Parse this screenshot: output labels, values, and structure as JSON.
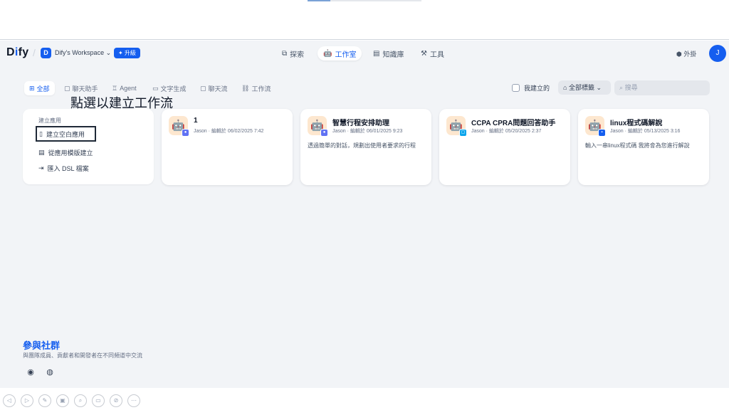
{
  "header": {
    "logo_pre": "D",
    "logo_accent": "i",
    "logo_post": "fy",
    "workspace_initial": "D",
    "workspace_name": "Dify's Workspace",
    "upgrade_label": "✦ 升級",
    "nav": [
      {
        "label": "探索",
        "icon": "compass-icon"
      },
      {
        "label": "工作室",
        "icon": "robot-icon"
      },
      {
        "label": "知識庫",
        "icon": "book-icon"
      },
      {
        "label": "工具",
        "icon": "hammer-icon"
      }
    ],
    "ext_label": "外掛",
    "avatar_initial": "J"
  },
  "tabs": [
    {
      "label": "全部",
      "icon": "grid-icon"
    },
    {
      "label": "聊天助手",
      "icon": "chat-icon"
    },
    {
      "label": "Agent",
      "icon": "agent-icon"
    },
    {
      "label": "文字生成",
      "icon": "text-icon"
    },
    {
      "label": "聊天流",
      "icon": "chatflow-icon"
    },
    {
      "label": "工作流",
      "icon": "workflow-icon"
    }
  ],
  "overlay_text": "點選以建立工作流",
  "filters": {
    "mine_label": "我建立的",
    "tags_label": "全部標籤",
    "search_placeholder": "搜尋"
  },
  "create": {
    "title": "建立應用",
    "blank": "建立空白應用",
    "template": "從應用模版建立",
    "dsl": "匯入 DSL 檔案"
  },
  "apps": [
    {
      "title": "1",
      "meta": "Jason · 編輯於 06/02/2025 7:42",
      "desc": "",
      "badge_color": "#6172f3"
    },
    {
      "title": "智慧行程安排助理",
      "meta": "Jason · 編輯於 06/01/2025 9:23",
      "desc": "透過簡單的對話，規劃出使用者要求的行程",
      "badge_color": "#6172f3"
    },
    {
      "title": "CCPA CPRA問題回答助手",
      "meta": "Jason · 編輯於 05/20/2025 2:37",
      "desc": "",
      "badge_color": "#0ba5ec"
    },
    {
      "title": "linux程式碼解說",
      "meta": "Jason · 編輯於 05/13/2025 3:16",
      "desc": "輸入一串linux程式碼 我將會為您進行解說",
      "badge_color": "#155eef"
    }
  ],
  "community": {
    "title": "參與社群",
    "desc": "與團隊成員、貢獻者和開發者在不同頻道中交流"
  }
}
